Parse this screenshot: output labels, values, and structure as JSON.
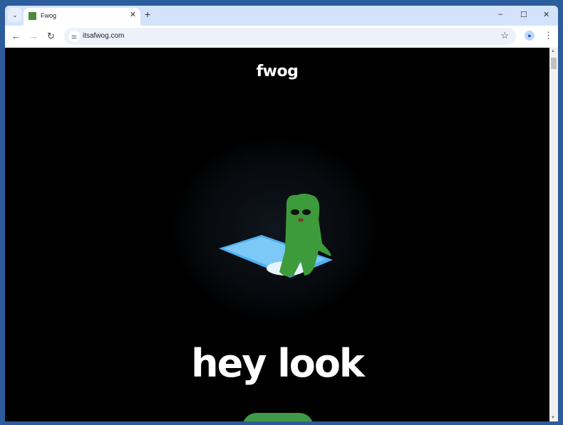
{
  "browser": {
    "tab_title": "Fwog",
    "url": "itsafwog.com"
  },
  "page": {
    "logo": "fwog",
    "headline": "hey look"
  },
  "icons": {
    "tab_menu": "chevron-down-icon",
    "close": "close-icon",
    "new_tab": "plus-icon",
    "back": "back-arrow-icon",
    "forward": "forward-arrow-icon",
    "reload": "reload-icon",
    "site_info": "tune-icon",
    "bookmark": "star-icon",
    "profile": "person-icon",
    "menu": "kebab-icon"
  }
}
